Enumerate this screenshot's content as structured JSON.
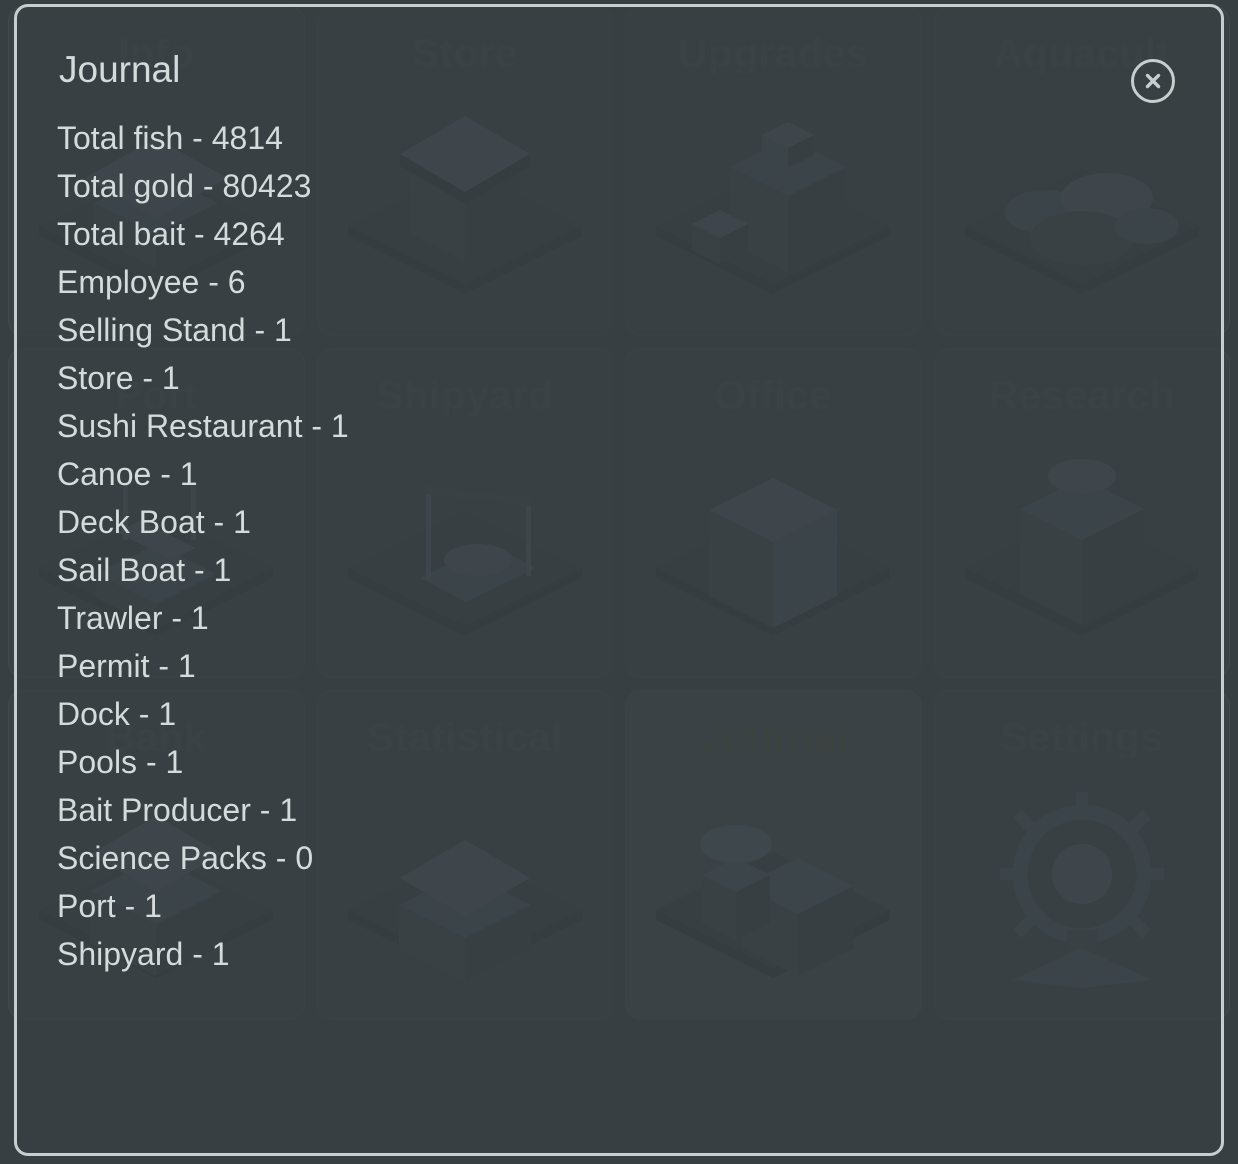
{
  "grid": {
    "tiles": [
      {
        "label": "Info",
        "icon": "house-icon",
        "active": false
      },
      {
        "label": "Store",
        "icon": "shop-icon",
        "active": false
      },
      {
        "label": "Upgrades",
        "icon": "factory-icon",
        "active": false
      },
      {
        "label": "Aquacult",
        "icon": "aquaculture-icon",
        "active": false
      },
      {
        "label": "Port",
        "icon": "port-icon",
        "active": false
      },
      {
        "label": "Shipyard",
        "icon": "shipyard-icon",
        "active": false
      },
      {
        "label": "Office",
        "icon": "office-icon",
        "active": false
      },
      {
        "label": "Research",
        "icon": "research-icon",
        "active": false
      },
      {
        "label": "Bank",
        "icon": "bank-icon",
        "active": false
      },
      {
        "label": "Statistical",
        "icon": "statistics-icon",
        "active": false
      },
      {
        "label": "Journal",
        "icon": "journal-icon",
        "active": true
      },
      {
        "label": "Settings",
        "icon": "ship-wheel-icon",
        "active": false
      }
    ]
  },
  "journal": {
    "title": "Journal",
    "close_label": "×",
    "entries": [
      "Total fish - 4814",
      "Total gold - 80423",
      "Total bait - 4264",
      "Employee - 6",
      "Selling Stand - 1",
      "Store - 1",
      "Sushi Restaurant - 1",
      "Canoe - 1",
      "Deck Boat - 1",
      "Sail Boat - 1",
      "Trawler - 1",
      "Permit - 1",
      "Dock - 1",
      "Pools - 1",
      "Bait Producer - 1",
      "Science Packs - 0",
      "Port - 1",
      "Shipyard - 1"
    ]
  },
  "colors": {
    "panel_background": "#3a4246",
    "page_background": "#383f43",
    "tile_active_background": "#434a52",
    "tile_label": "#434b4f",
    "tile_label_active": "#4c4a2e",
    "overlay_border": "#c8cdcd",
    "overlay_text": "#d5dadb"
  }
}
